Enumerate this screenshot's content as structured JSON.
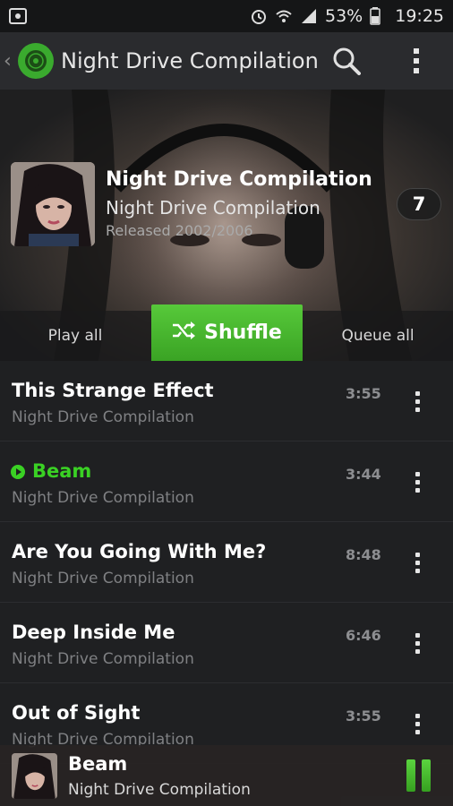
{
  "status_bar": {
    "battery": "53%",
    "time": "19:25",
    "icons": [
      "cast-icon",
      "alarm-icon",
      "wifi-icon",
      "signal-icon",
      "battery-icon"
    ]
  },
  "app_bar": {
    "title": "Night Drive Compilation",
    "icons": [
      "back-chevron-icon",
      "app-logo-icon",
      "search-icon",
      "overflow-menu-icon"
    ]
  },
  "album": {
    "title": "Night Drive Compilation",
    "subtitle": "Night Drive Compilation",
    "released": "Released 2002/2006",
    "track_count": "7"
  },
  "actions": {
    "play_all": "Play all",
    "shuffle": "Shuffle",
    "queue_all": "Queue all"
  },
  "tracks": [
    {
      "title": "This Strange Effect",
      "album": "Night Drive Compilation",
      "duration": "3:55",
      "playing": false
    },
    {
      "title": "Beam",
      "album": "Night Drive Compilation",
      "duration": "3:44",
      "playing": true
    },
    {
      "title": "Are You Going With Me?",
      "album": "Night Drive Compilation",
      "duration": "8:48",
      "playing": false
    },
    {
      "title": "Deep Inside Me",
      "album": "Night Drive Compilation",
      "duration": "6:46",
      "playing": false
    },
    {
      "title": "Out of Sight",
      "album": "Night Drive Compilation",
      "duration": "3:55",
      "playing": false
    }
  ],
  "now_playing": {
    "title": "Beam",
    "subtitle": "Night Drive Compilation",
    "state": "playing"
  },
  "colors": {
    "accent": "#3ad124",
    "button_green": "#4bbb30",
    "background": "#1f2022",
    "app_bar": "#2a2b2e"
  }
}
